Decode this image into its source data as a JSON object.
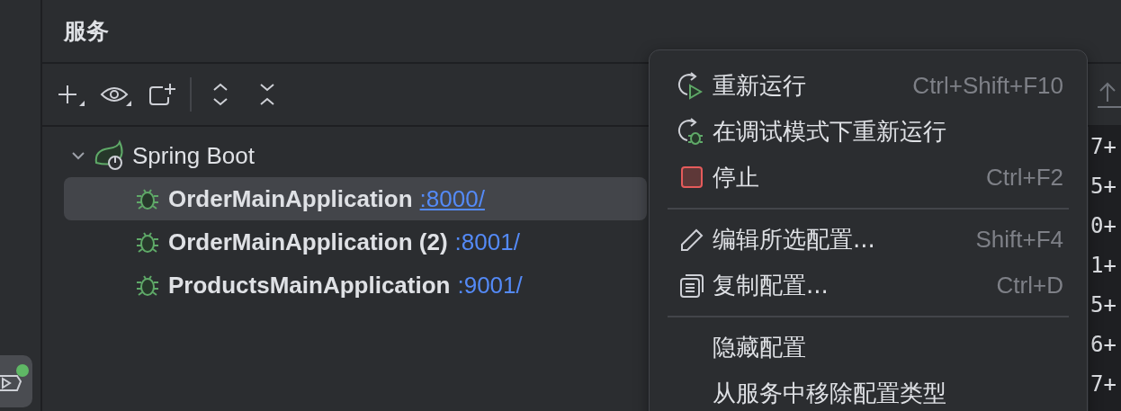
{
  "panel": {
    "title": "服务"
  },
  "tree": [
    {
      "label": "Spring Boot",
      "expanded": true,
      "children": [
        {
          "name": "OrderMainApplication",
          "port": ":8000/",
          "selected": true,
          "hovered": true
        },
        {
          "name": "OrderMainApplication (2)",
          "port": ":8001/",
          "selected": false,
          "hovered": false
        },
        {
          "name": "ProductsMainApplication",
          "port": ":9001/",
          "selected": false,
          "hovered": false
        }
      ]
    }
  ],
  "console_lines": [
    "7+",
    "5+",
    "0+",
    "1+",
    "5+",
    "6+",
    "7+"
  ],
  "context_menu": [
    {
      "kind": "item",
      "label": "重新运行",
      "shortcut": "Ctrl+Shift+F10"
    },
    {
      "kind": "item",
      "label": "在调试模式下重新运行"
    },
    {
      "kind": "item",
      "label": "停止",
      "shortcut": "Ctrl+F2"
    },
    {
      "kind": "separator"
    },
    {
      "kind": "item",
      "label": "编辑所选配置...",
      "shortcut": "Shift+F4"
    },
    {
      "kind": "item",
      "label": "复制配置...",
      "shortcut": "Ctrl+D"
    },
    {
      "kind": "separator"
    },
    {
      "kind": "item",
      "label": "隐藏配置"
    },
    {
      "kind": "item",
      "label": "从服务中移除配置类型"
    }
  ],
  "side_tool": {
    "active": true,
    "running": true
  }
}
